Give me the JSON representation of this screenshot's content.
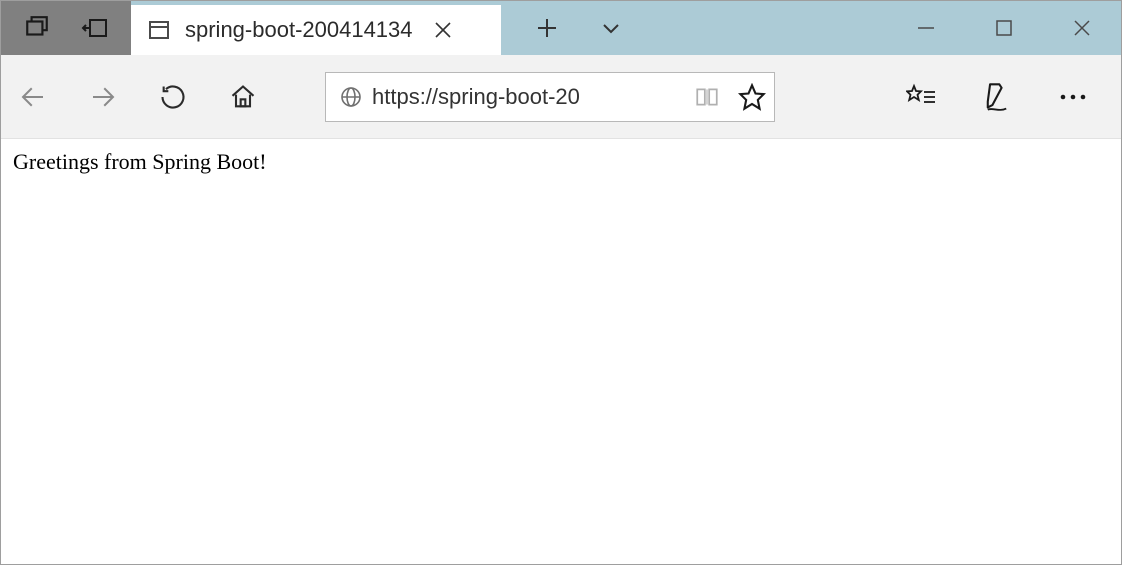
{
  "titlebar": {
    "tab_title": "spring-boot-200414134"
  },
  "toolbar": {
    "url_display": "https://spring-boot-20"
  },
  "page": {
    "body_text": "Greetings from Spring Boot!"
  }
}
